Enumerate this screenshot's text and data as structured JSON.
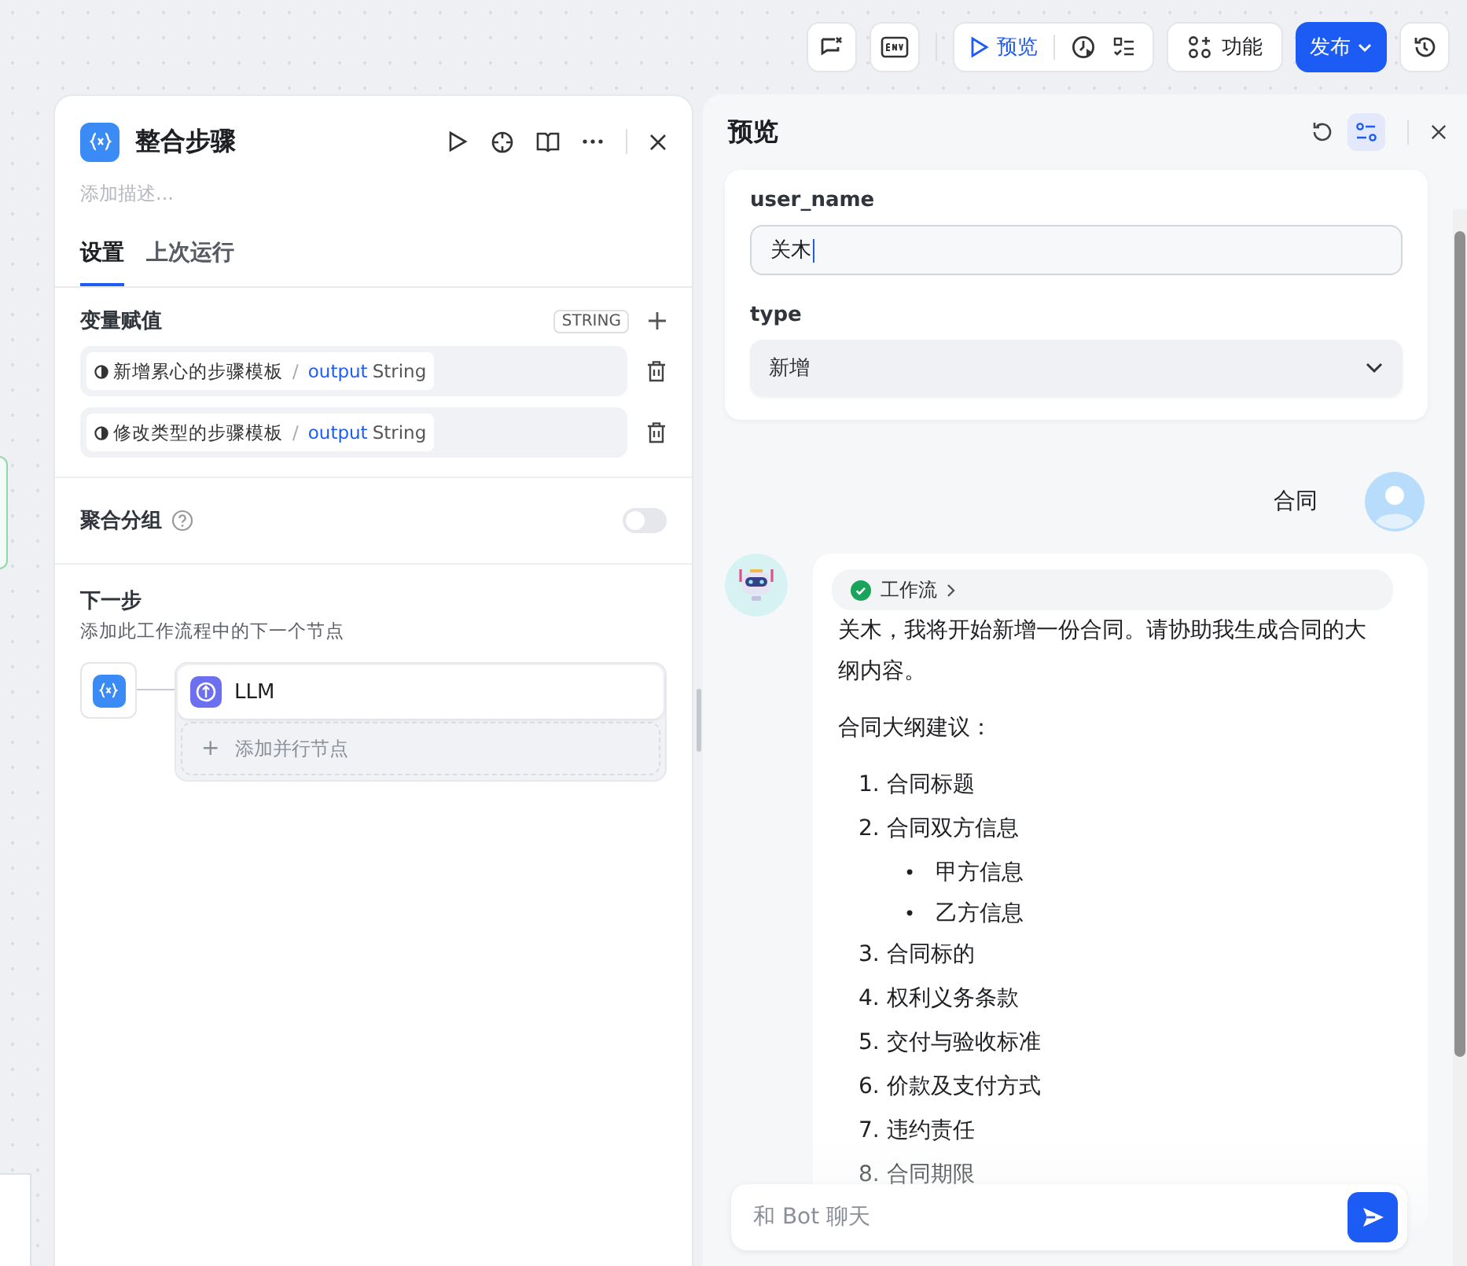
{
  "toolbar": {
    "preview_label": "预览",
    "feature_label": "功能",
    "publish_label": "发布"
  },
  "node_panel": {
    "title": "整合步骤",
    "description_placeholder": "添加描述...",
    "tabs": [
      {
        "label": "设置",
        "selected": true
      },
      {
        "label": "上次运行",
        "selected": false
      }
    ],
    "variables": {
      "title": "变量赋值",
      "type_tag": "STRING",
      "rows": [
        {
          "source": "新增累心的步骤模板",
          "separator": "/",
          "field": "output",
          "type": "String"
        },
        {
          "source": "修改类型的步骤模板",
          "separator": "/",
          "field": "output",
          "type": "String"
        }
      ]
    },
    "group": {
      "label": "聚合分组",
      "on": false
    },
    "next_step": {
      "title": "下一步",
      "subtitle": "添加此工作流程中的下一个节点",
      "next_node": "LLM",
      "add_parallel": "添加并行节点",
      "plus": "+"
    }
  },
  "preview": {
    "title": "预览",
    "settings_selected": true,
    "fields": [
      {
        "kind": "text",
        "label": "user_name",
        "value": "关木"
      },
      {
        "kind": "select",
        "label": "type",
        "value": "新增"
      }
    ],
    "chat": {
      "user_message": "合同",
      "workflow_tag": "工作流",
      "paragraphs": [
        "关木，我将开始新增一份合同。请协助我生成合同的大纲内容。",
        "合同大纲建议："
      ],
      "outline": [
        {
          "number": "1.",
          "text": "合同标题"
        },
        {
          "number": "2.",
          "text": "合同双方信息",
          "children": [
            {
              "bullet": "•",
              "text": "甲方信息"
            },
            {
              "bullet": "•",
              "text": "乙方信息"
            }
          ]
        },
        {
          "number": "3.",
          "text": "合同标的"
        },
        {
          "number": "4.",
          "text": "权利义务条款"
        },
        {
          "number": "5.",
          "text": "交付与验收标准"
        },
        {
          "number": "6.",
          "text": "价款及支付方式"
        },
        {
          "number": "7.",
          "text": "违约责任"
        },
        {
          "number": "8.",
          "text": "合同期限"
        }
      ]
    },
    "input_placeholder": "和 Bot 聊天"
  }
}
